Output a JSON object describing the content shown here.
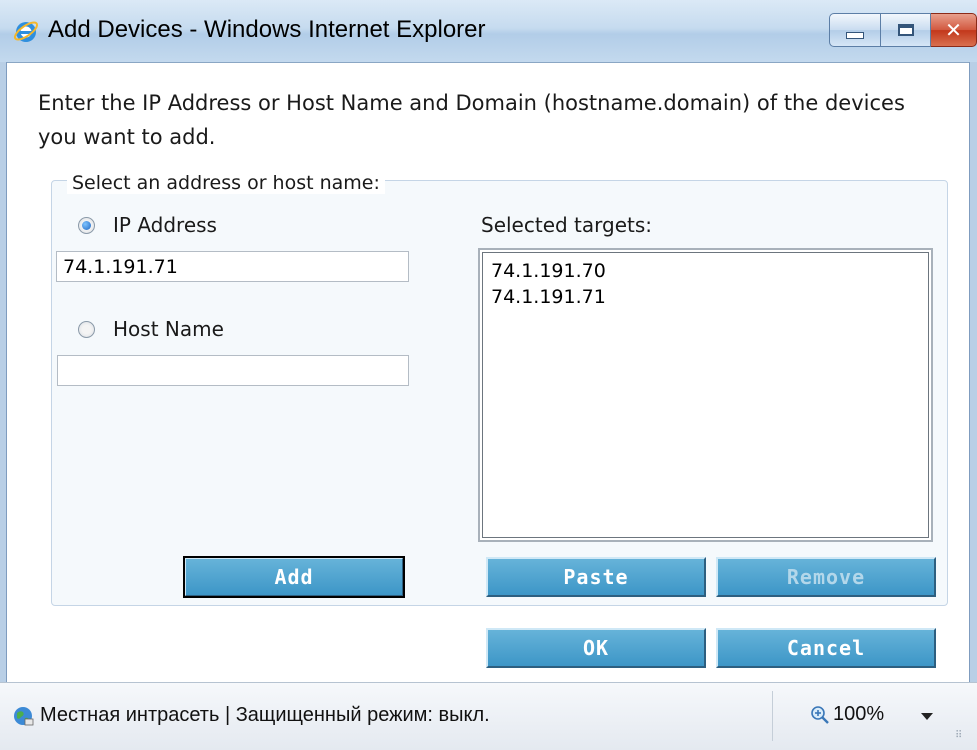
{
  "window": {
    "title": "Add Devices - Windows Internet Explorer",
    "title_icon": "internet-explorer-icon",
    "controls": [
      "minimize",
      "maximize",
      "close"
    ],
    "close_glyph": "✕"
  },
  "dialog": {
    "intro": "Enter the IP Address or Host Name and Domain (hostname.domain) of the devices you want to add.",
    "group_legend": "Select an address or host name:",
    "ip_option": {
      "label": "IP Address",
      "selected": true,
      "value": "74.1.191.71"
    },
    "host_option": {
      "label": "Host Name",
      "selected": false,
      "value": ""
    },
    "targets_label": "Selected targets:",
    "targets": [
      "74.1.191.70",
      "74.1.191.71"
    ],
    "buttons": {
      "add": "Add",
      "paste": "Paste",
      "remove": "Remove",
      "ok": "OK",
      "cancel": "Cancel"
    },
    "colors": {
      "button": "#4aa3d0",
      "button_text": "#ffffff",
      "button_disabled_text": "#b3d7ea"
    }
  },
  "statusbar": {
    "zone": "Местная интрасеть | Защищенный режим: выкл.",
    "zone_icon": "globe-icon",
    "zoom": "100%",
    "zoom_icon": "zoom-icon"
  }
}
